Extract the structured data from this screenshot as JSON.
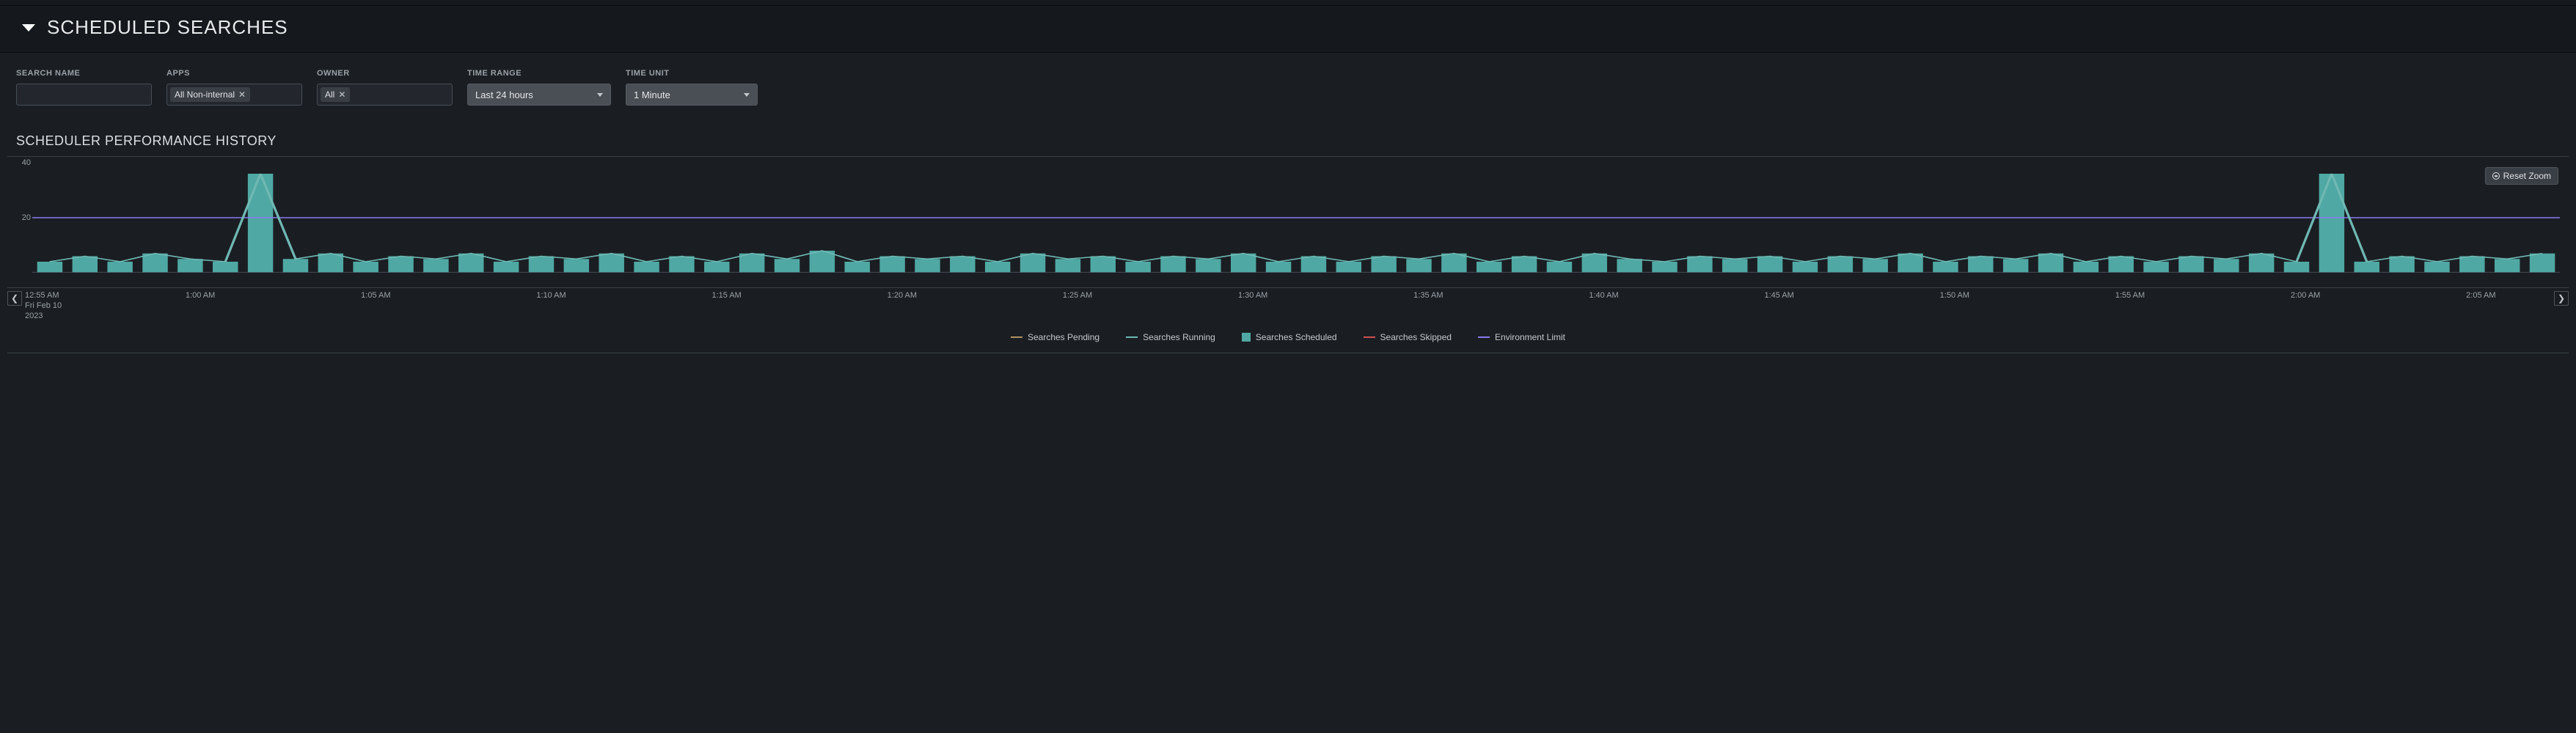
{
  "header": {
    "title": "SCHEDULED SEARCHES"
  },
  "filters": {
    "search_name": {
      "label": "SEARCH NAME",
      "value": ""
    },
    "apps": {
      "label": "APPS",
      "chips": [
        "All Non-internal"
      ]
    },
    "owner": {
      "label": "OWNER",
      "chips": [
        "All"
      ]
    },
    "time_range": {
      "label": "TIME RANGE",
      "value": "Last 24 hours"
    },
    "time_unit": {
      "label": "TIME UNIT",
      "value": "1 Minute"
    }
  },
  "section_title": "SCHEDULER PERFORMANCE HISTORY",
  "reset_zoom_label": "Reset Zoom",
  "legend": {
    "pending": "Searches Pending",
    "running": "Searches Running",
    "scheduled": "Searches Scheduled",
    "skipped": "Searches Skipped",
    "limit": "Environment Limit"
  },
  "colors": {
    "pending": "#b09060",
    "running": "#6fb8b3",
    "scheduled": "#4fa8a3",
    "skipped": "#d05050",
    "limit": "#8a7af0"
  },
  "chart_data": {
    "type": "bar",
    "title": "Scheduler Performance History",
    "ylabel": "",
    "ylim": [
      0,
      40
    ],
    "y_ticks": [
      20,
      40
    ],
    "environment_limit": 20,
    "x_tick_interval_minutes": 5,
    "x_tick_labels": [
      {
        "label": "12:55 AM",
        "sub1": "Fri Feb 10",
        "sub2": "2023"
      },
      {
        "label": "1:00 AM"
      },
      {
        "label": "1:05 AM"
      },
      {
        "label": "1:10 AM"
      },
      {
        "label": "1:15 AM"
      },
      {
        "label": "1:20 AM"
      },
      {
        "label": "1:25 AM"
      },
      {
        "label": "1:30 AM"
      },
      {
        "label": "1:35 AM"
      },
      {
        "label": "1:40 AM"
      },
      {
        "label": "1:45 AM"
      },
      {
        "label": "1:50 AM"
      },
      {
        "label": "1:55 AM"
      },
      {
        "label": "2:00 AM"
      },
      {
        "label": "2:05 AM"
      }
    ],
    "series": [
      {
        "name": "Searches Scheduled",
        "role": "bar",
        "values": [
          4,
          6,
          4,
          7,
          5,
          4,
          36,
          5,
          7,
          4,
          6,
          5,
          7,
          4,
          6,
          5,
          7,
          4,
          6,
          4,
          7,
          5,
          8,
          4,
          6,
          5,
          6,
          4,
          7,
          5,
          6,
          4,
          6,
          5,
          7,
          4,
          6,
          4,
          6,
          5,
          7,
          4,
          6,
          4,
          7,
          5,
          4,
          6,
          5,
          6,
          4,
          6,
          5,
          7,
          4,
          6,
          5,
          7,
          4,
          6,
          4,
          6,
          5,
          7,
          4,
          36,
          4,
          6,
          4,
          6,
          5,
          7
        ]
      },
      {
        "name": "Searches Running",
        "role": "line",
        "values": [
          4,
          6,
          4,
          7,
          5,
          4,
          36,
          5,
          7,
          4,
          6,
          5,
          7,
          4,
          6,
          5,
          7,
          4,
          6,
          4,
          7,
          5,
          8,
          4,
          6,
          5,
          6,
          4,
          7,
          5,
          6,
          4,
          6,
          5,
          7,
          4,
          6,
          4,
          6,
          5,
          7,
          4,
          6,
          4,
          7,
          5,
          4,
          6,
          5,
          6,
          4,
          6,
          5,
          7,
          4,
          6,
          5,
          7,
          4,
          6,
          4,
          6,
          5,
          7,
          4,
          36,
          4,
          6,
          4,
          6,
          5,
          7
        ]
      },
      {
        "name": "Searches Pending",
        "role": "line",
        "values": []
      },
      {
        "name": "Searches Skipped",
        "role": "line",
        "values": []
      }
    ]
  }
}
